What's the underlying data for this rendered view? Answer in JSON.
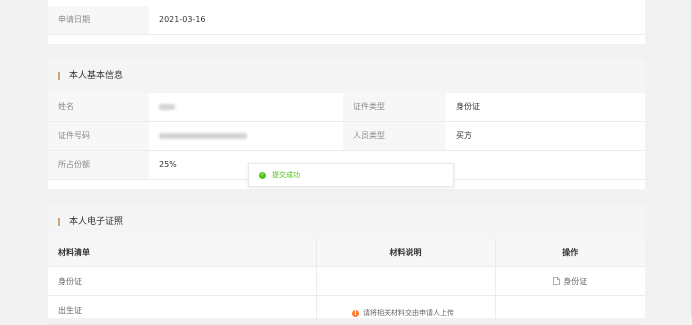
{
  "apply": {
    "label": "申请日期",
    "value": "2021-03-16"
  },
  "basic": {
    "title": "本人基本信息",
    "rows": [
      {
        "l1": "姓名",
        "v1": "",
        "l2": "证件类型",
        "v2": "身份证"
      },
      {
        "l1": "证件号码",
        "v1": "",
        "l2": "人员类型",
        "v2": "买方"
      },
      {
        "l1": "所占份额",
        "v1": "25%",
        "l2": "",
        "v2": ""
      }
    ]
  },
  "toast": {
    "text": "提交成功"
  },
  "cert": {
    "title": "本人电子证照",
    "headers": [
      "材料清单",
      "材料说明",
      "操作"
    ],
    "rows": [
      {
        "name": "身份证",
        "desc": "",
        "action": "身份证"
      },
      {
        "name": "出生证",
        "desc": "",
        "action": ""
      }
    ],
    "tip": "请将相关材料交由申请人上传"
  },
  "colors": {
    "accent": "#c8a774",
    "success": "#52c41a",
    "warning": "#ff7a2e"
  }
}
